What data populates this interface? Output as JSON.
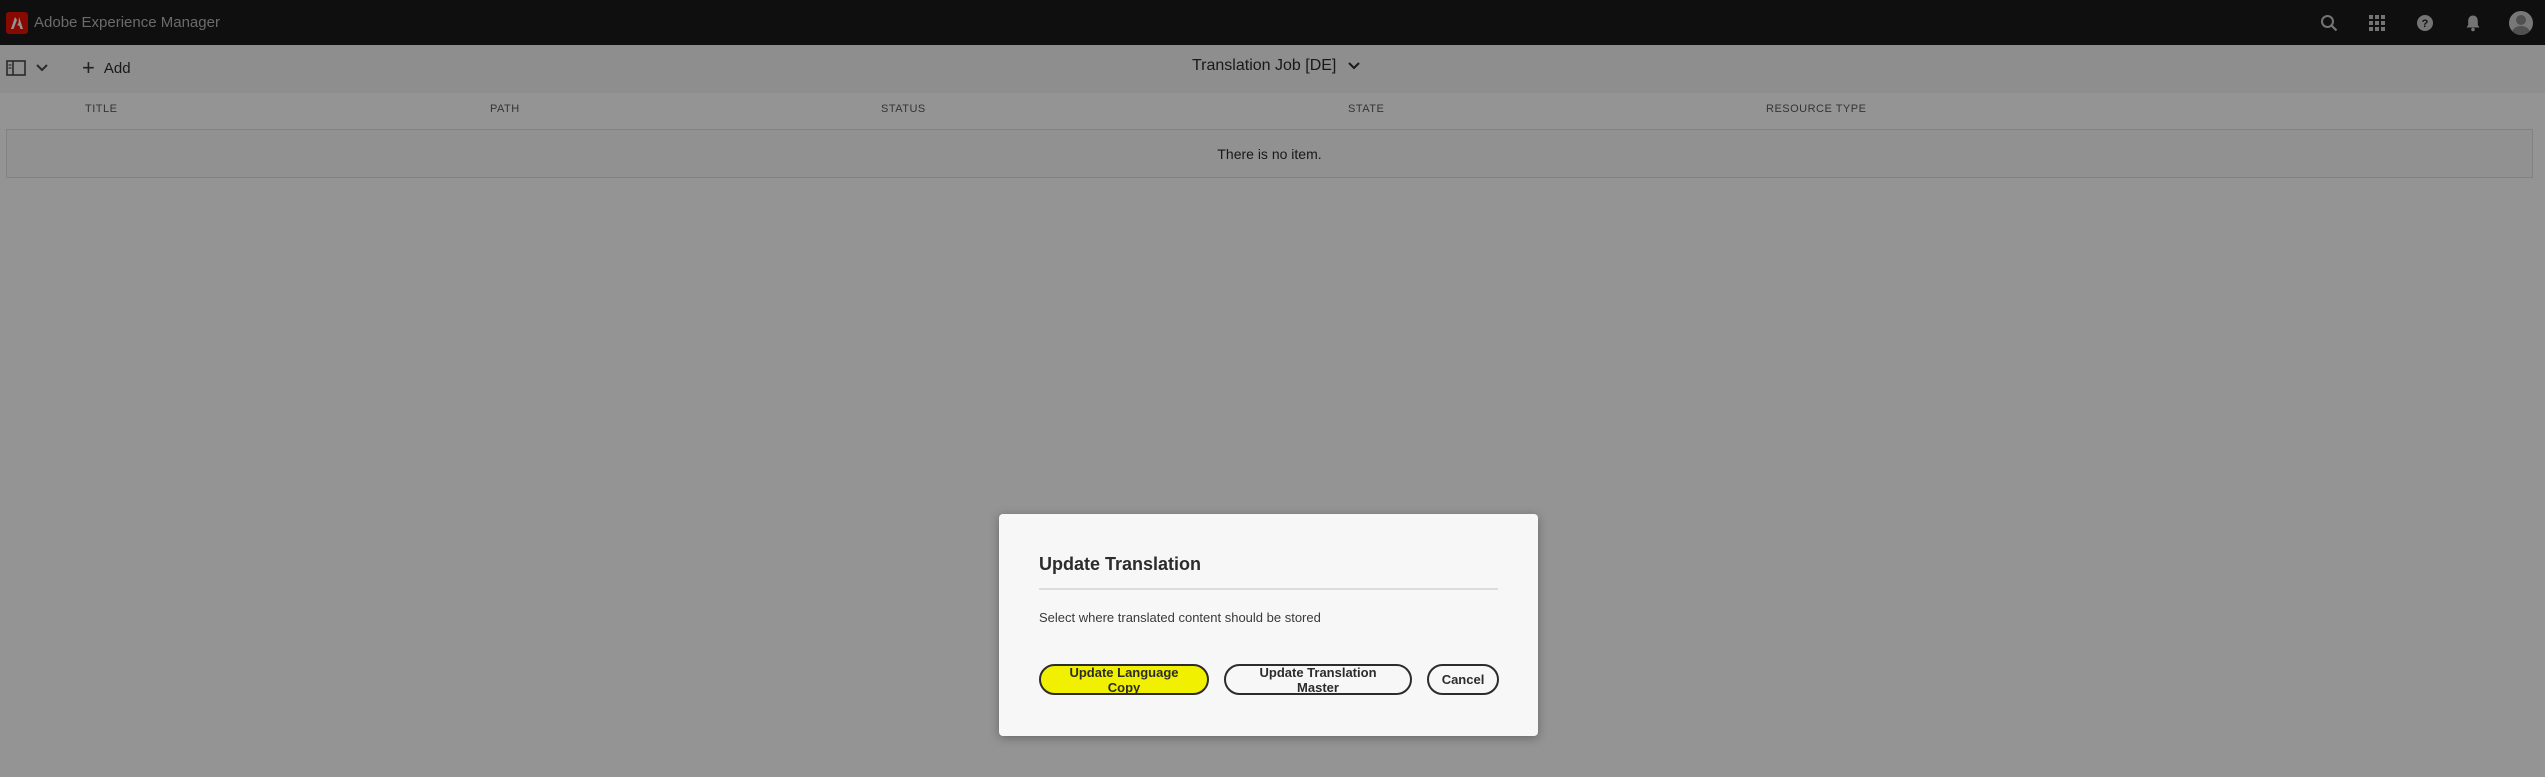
{
  "app": {
    "name": "Adobe Experience Manager"
  },
  "header": {
    "icons": [
      "search-icon",
      "apps-grid-icon",
      "help-icon",
      "notifications-icon",
      "user-avatar"
    ]
  },
  "actionbar": {
    "add_label": "Add",
    "title": "Translation Job [DE]"
  },
  "table": {
    "columns": [
      "TITLE",
      "PATH",
      "STATUS",
      "STATE",
      "RESOURCE TYPE"
    ],
    "empty_message": "There is no item."
  },
  "dialog": {
    "title": "Update Translation",
    "message": "Select where translated content should be stored",
    "buttons": {
      "update_language_copy": "Update Language Copy",
      "update_translation_master": "Update Translation Master",
      "cancel": "Cancel"
    }
  },
  "colors": {
    "header_bg": "#1a1a1a",
    "brand_red": "#eb1000",
    "highlight": "#f0f000"
  }
}
